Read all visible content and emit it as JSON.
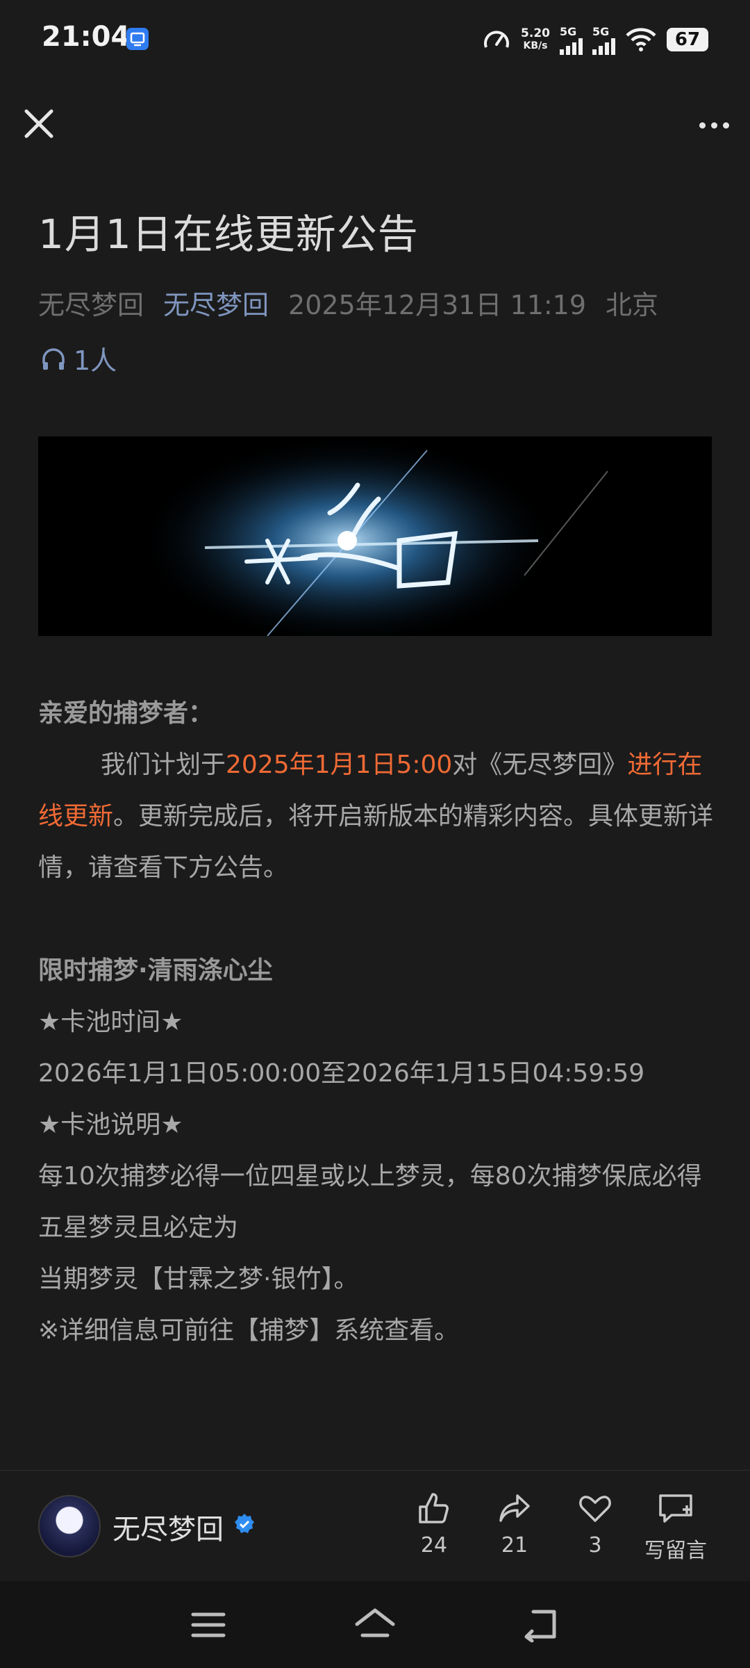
{
  "status": {
    "time": "21:04",
    "speed_value": "5.20",
    "speed_unit": "KB/s",
    "sim1": "5G",
    "sim2": "5G",
    "battery": "67"
  },
  "article": {
    "title": "1月1日在线更新公告",
    "author_plain": "无尽梦回",
    "author_link": "无尽梦回",
    "datetime": "2025年12月31日 11:19",
    "location": "北京",
    "listeners": "1人"
  },
  "body": {
    "greeting": "亲爱的捕梦者：",
    "p1_a": "我们计划于",
    "p1_hl1": "2025年1月1日5:00",
    "p1_b": "对《无尽梦回》",
    "p1_hl2": "进行在线更新",
    "p1_c": "。更新完成后，将开启新版本的精彩内容。具体更新详情，请查看下方公告。",
    "section_title": "限时捕梦·清雨涤心尘",
    "pool_time_label": "★卡池时间★",
    "pool_time": "2026年1月1日05:00:00至2026年1月15日04:59:59",
    "pool_desc_label": "★卡池说明★",
    "pool_desc_1": "每10次捕梦必得一位四星或以上梦灵，每80次捕梦保底必得五星梦灵且必定为",
    "pool_desc_2": "当期梦灵【甘霖之梦·银竹】。",
    "pool_note": "※详细信息可前往【捕梦】系统查看。"
  },
  "bottom": {
    "author": "无尽梦回",
    "likes": "24",
    "shares": "21",
    "favorites": "3",
    "comment": "写留言"
  },
  "colors": {
    "background": "#1b1b1b",
    "highlight": "#f06a35",
    "link": "#7f96bf"
  }
}
